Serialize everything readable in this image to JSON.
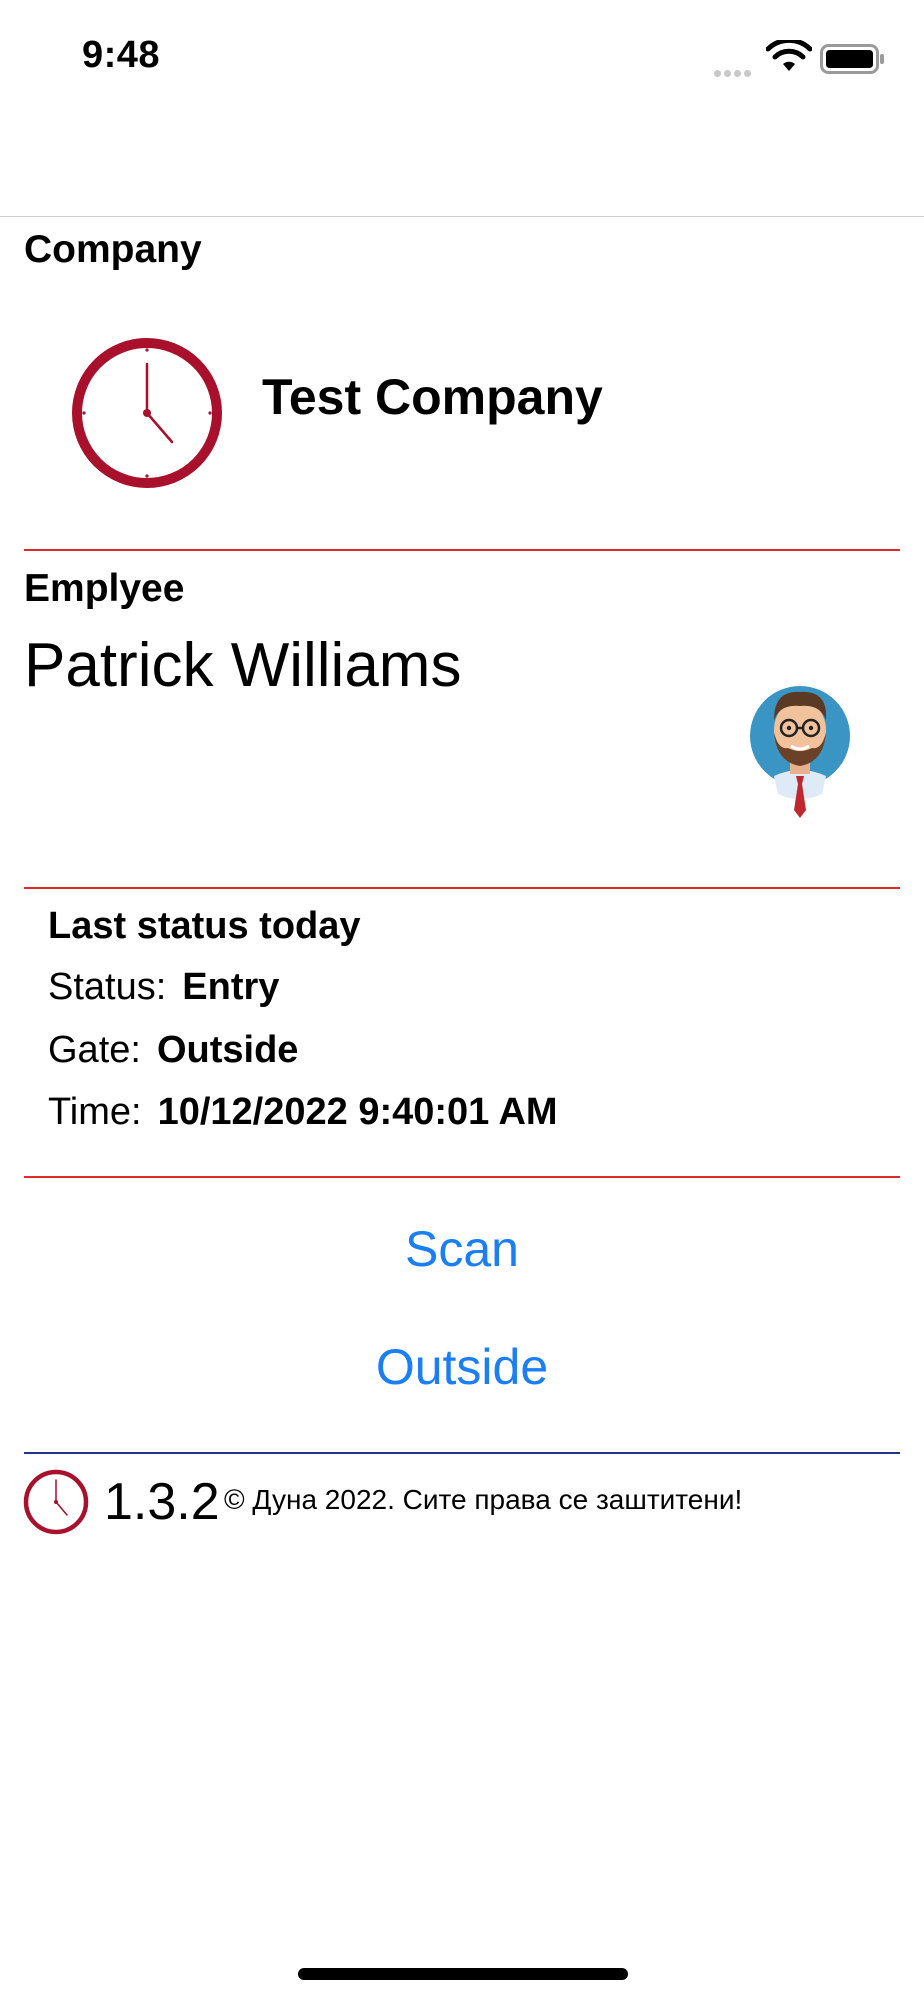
{
  "status_bar": {
    "time": "9:48",
    "icons": [
      "signal-icon",
      "wifi-icon",
      "battery-icon"
    ]
  },
  "company": {
    "label": "Company",
    "name": "Test Company",
    "logo_icon": "clock-logo-icon"
  },
  "employee": {
    "label": "Emplyee",
    "name": "Patrick Williams",
    "avatar_icon": "employee-avatar-icon"
  },
  "last_status": {
    "heading": "Last status today",
    "status_label": "Status:",
    "status_value": "Entry",
    "gate_label": "Gate:",
    "gate_value": "Outside",
    "time_label": "Time:",
    "time_value": "10/12/2022 9:40:01 AM"
  },
  "actions": {
    "scan_label": "Scan",
    "outside_label": "Outside"
  },
  "footer": {
    "version": "1.3.2",
    "copyright": "© Дуна 2022. Сите права се заштитени!"
  },
  "colors": {
    "accent_link": "#1a7ef5",
    "divider_red": "#e02a2a",
    "divider_blue": "#23338a",
    "logo_red": "#a8102c"
  }
}
